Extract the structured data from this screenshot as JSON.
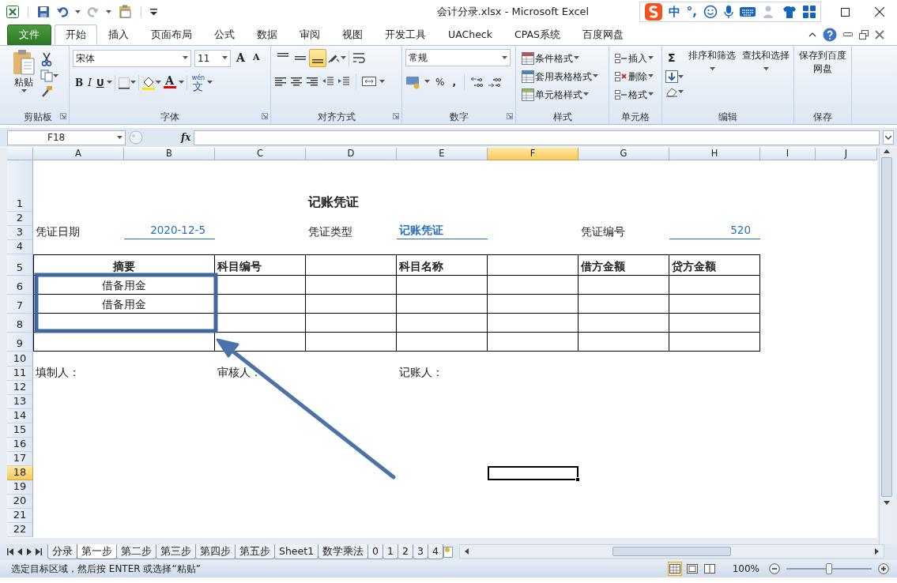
{
  "window": {
    "title": "会计分录.xlsx  -  Microsoft Excel"
  },
  "ime_bar": {
    "mode": "中",
    "punctuation": "°,"
  },
  "ribbon_tabs": [
    {
      "label": "文件",
      "kind": "file",
      "selected": false
    },
    {
      "label": "开始",
      "kind": "tab",
      "selected": true
    },
    {
      "label": "插入",
      "kind": "tab",
      "selected": false
    },
    {
      "label": "页面布局",
      "kind": "tab",
      "selected": false
    },
    {
      "label": "公式",
      "kind": "tab",
      "selected": false
    },
    {
      "label": "数据",
      "kind": "tab",
      "selected": false
    },
    {
      "label": "审阅",
      "kind": "tab",
      "selected": false
    },
    {
      "label": "视图",
      "kind": "tab",
      "selected": false
    },
    {
      "label": "开发工具",
      "kind": "tab",
      "selected": false
    },
    {
      "label": "UACheck",
      "kind": "tab",
      "selected": false
    },
    {
      "label": "CPAS系统",
      "kind": "tab",
      "selected": false
    },
    {
      "label": "百度网盘",
      "kind": "tab",
      "selected": false
    }
  ],
  "ribbon_groups": [
    {
      "kind": "clipboard",
      "label": "剪贴板",
      "paste": "粘贴"
    },
    {
      "kind": "font",
      "label": "字体",
      "font": "宋体",
      "size": "11",
      "grow": "A",
      "shrink": "A",
      "bold": "B",
      "italic": "I",
      "underline": "U",
      "font_color": "A",
      "phonetic_top": "wén",
      "phonetic_bottom": "文"
    },
    {
      "kind": "alignment",
      "label": "对齐方式",
      "vertical": [
        {
          "selected": false
        },
        {
          "selected": false
        },
        {
          "selected": true
        }
      ]
    },
    {
      "kind": "number",
      "label": "数字",
      "format": "常规",
      "percent": "%",
      "comma": ","
    },
    {
      "kind": "styles",
      "label": "样式",
      "items": [
        "条件格式",
        "套用表格格式",
        "单元格样式"
      ]
    },
    {
      "kind": "cells",
      "label": "单元格",
      "items": [
        "插入",
        "删除",
        "格式"
      ]
    },
    {
      "kind": "editing",
      "label": "编辑",
      "sum": "Σ",
      "items": [
        "排序和筛选",
        "查找和选择"
      ]
    },
    {
      "kind": "save",
      "label": "保存",
      "items": [
        "保存到百度网盘"
      ]
    }
  ],
  "formula_bar": {
    "name_box": "F18",
    "fx": "fx"
  },
  "sheet": {
    "columns": [
      {
        "label": "A",
        "selected": false
      },
      {
        "label": "B",
        "selected": false
      },
      {
        "label": "C",
        "selected": false
      },
      {
        "label": "D",
        "selected": false
      },
      {
        "label": "E",
        "selected": false
      },
      {
        "label": "F",
        "selected": true
      },
      {
        "label": "G",
        "selected": false
      },
      {
        "label": "H",
        "selected": false
      },
      {
        "label": "I",
        "selected": false
      },
      {
        "label": "J",
        "selected": false
      }
    ],
    "rows": [
      {
        "label": "1",
        "selected": false
      },
      {
        "label": "2",
        "selected": false
      },
      {
        "label": "3",
        "selected": false
      },
      {
        "label": "4",
        "selected": false
      },
      {
        "label": "5",
        "selected": false
      },
      {
        "label": "6",
        "selected": false
      },
      {
        "label": "7",
        "selected": false
      },
      {
        "label": "8",
        "selected": false
      },
      {
        "label": "9",
        "selected": false
      },
      {
        "label": "10",
        "selected": false
      },
      {
        "label": "11",
        "selected": false
      },
      {
        "label": "12",
        "selected": false
      },
      {
        "label": "13",
        "selected": false
      },
      {
        "label": "14",
        "selected": false
      },
      {
        "label": "15",
        "selected": false
      },
      {
        "label": "16",
        "selected": false
      },
      {
        "label": "17",
        "selected": false
      },
      {
        "label": "18",
        "selected": true
      },
      {
        "label": "19",
        "selected": false
      },
      {
        "label": "20",
        "selected": false
      },
      {
        "label": "21",
        "selected": false
      },
      {
        "label": "22",
        "selected": false
      }
    ],
    "cells": [
      {
        "text": "记账凭证",
        "kind": "title"
      },
      {
        "text": "凭证日期",
        "kind": "label"
      },
      {
        "text": "2020-12-5",
        "kind": "field"
      },
      {
        "text": "凭证类型",
        "kind": "label"
      },
      {
        "text": "记账凭证",
        "kind": "field"
      },
      {
        "text": "凭证编号",
        "kind": "label"
      },
      {
        "text": "520",
        "kind": "field"
      },
      {
        "text": "摘要",
        "kind": "header"
      },
      {
        "text": "科目编号",
        "kind": "header"
      },
      {
        "text": "科目名称",
        "kind": "header"
      },
      {
        "text": "借方金额",
        "kind": "header"
      },
      {
        "text": "贷方金额",
        "kind": "header"
      },
      {
        "text": "借备用金",
        "kind": "entry"
      },
      {
        "text": "借备用金",
        "kind": "entry"
      },
      {
        "text": "填制人：",
        "kind": "label"
      },
      {
        "text": "审核人：",
        "kind": "label"
      },
      {
        "text": "记账人：",
        "kind": "label"
      }
    ],
    "annotations": [
      {
        "kind": "rectangle",
        "color": "#41689e"
      },
      {
        "kind": "arrow",
        "color": "#4a73a8"
      }
    ]
  },
  "sheet_tabs": [
    {
      "label": "分录",
      "selected": false
    },
    {
      "label": "第一步",
      "selected": true
    },
    {
      "label": "第二步",
      "selected": false
    },
    {
      "label": "第三步",
      "selected": false
    },
    {
      "label": "第四步",
      "selected": false
    },
    {
      "label": "第五步",
      "selected": false
    },
    {
      "label": "Sheet1",
      "selected": false
    },
    {
      "label": "数学乘法",
      "selected": false
    },
    {
      "label": "0",
      "selected": false
    },
    {
      "label": "1",
      "selected": false
    },
    {
      "label": "2",
      "selected": false
    },
    {
      "label": "3",
      "selected": false
    },
    {
      "label": "4",
      "selected": false
    }
  ],
  "status_bar": {
    "message": "选定目标区域，然后按 ENTER 或选择“粘贴”",
    "views": [
      {
        "selected": true
      },
      {
        "selected": false
      },
      {
        "selected": false
      }
    ],
    "zoom": "100%",
    "zoom_slider": {
      "level": 0.5
    }
  }
}
